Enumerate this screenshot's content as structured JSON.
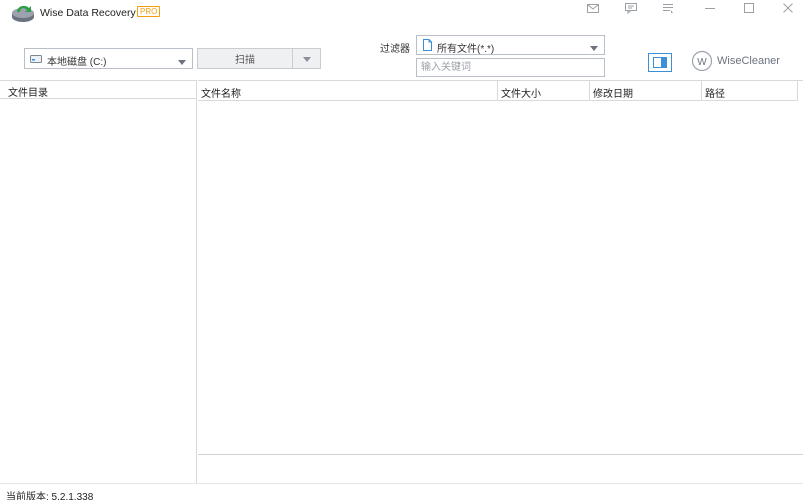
{
  "window": {
    "title": "Wise Data Recovery",
    "badge": "PRO",
    "controls": [
      "mail-icon",
      "feedback-icon",
      "menu-icon",
      "minimize-icon",
      "maximize-icon",
      "close-icon"
    ]
  },
  "toolbar": {
    "drive_selected": "本地磁盘 (C:)",
    "scan_label": "扫描",
    "filter_label": "过滤器",
    "filter_selected": "所有文件(*.*)",
    "keyword_placeholder": "输入关键词",
    "keyword_value": ""
  },
  "brand": {
    "name": "WiseCleaner",
    "logo_letter": "W"
  },
  "directory_panel": {
    "header": "文件目录"
  },
  "file_table": {
    "columns": [
      "文件名称",
      "文件大小",
      "修改日期",
      "路径"
    ],
    "rows": []
  },
  "status": {
    "version_text": "当前版本: 5.2.1.338"
  },
  "colors": {
    "accent": "#3a8fd8",
    "pro_badge": "#f59e0b",
    "logo_green": "#2e9e48",
    "border": "#d6d9dd"
  }
}
